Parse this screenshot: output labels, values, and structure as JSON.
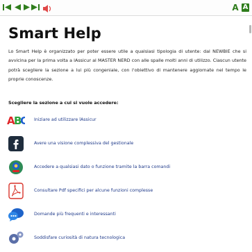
{
  "toolbar": {
    "font_increase": "A",
    "font_decrease": "A"
  },
  "page": {
    "title": "Smart Help",
    "intro": "Lo Smart Help è organizzato per poter essere utile a qualsiasi tipologia di utente: dal NEWBIE che si avvicina per la prima volta a lAssicur al MASTER NERD con alle spalle molti anni di utilizzo. Ciascun utente potrà scegliere la sezione a lui più congeniale, con l'obiettivo di mantenere aggiornate nel tempo le proprie conoscenze.",
    "choose_label": "Scegliere la sezione a cui si vuole accedere:"
  },
  "sections": [
    {
      "label": "Iniziare ad utilizzare lAssicur",
      "icon": "abc-icon"
    },
    {
      "label": "Avere una visione complessiva del gestionale",
      "icon": "facebook-icon"
    },
    {
      "label": "Accedere a qualsiasi dato o funzione tramite la barra comandi",
      "icon": "compass-icon"
    },
    {
      "label": "Consultare Pdf specifici per alcune funzioni complesse",
      "icon": "pdf-icon"
    },
    {
      "label": "Domande più frequenti e interessanti",
      "icon": "chat-bubbles-icon"
    },
    {
      "label": "Soddisfare curiosità di natura tecnologica",
      "icon": "gears-icon"
    }
  ],
  "colors": {
    "toolbar_green": "#2f7d1c",
    "link_blue": "#1f3a8a"
  }
}
